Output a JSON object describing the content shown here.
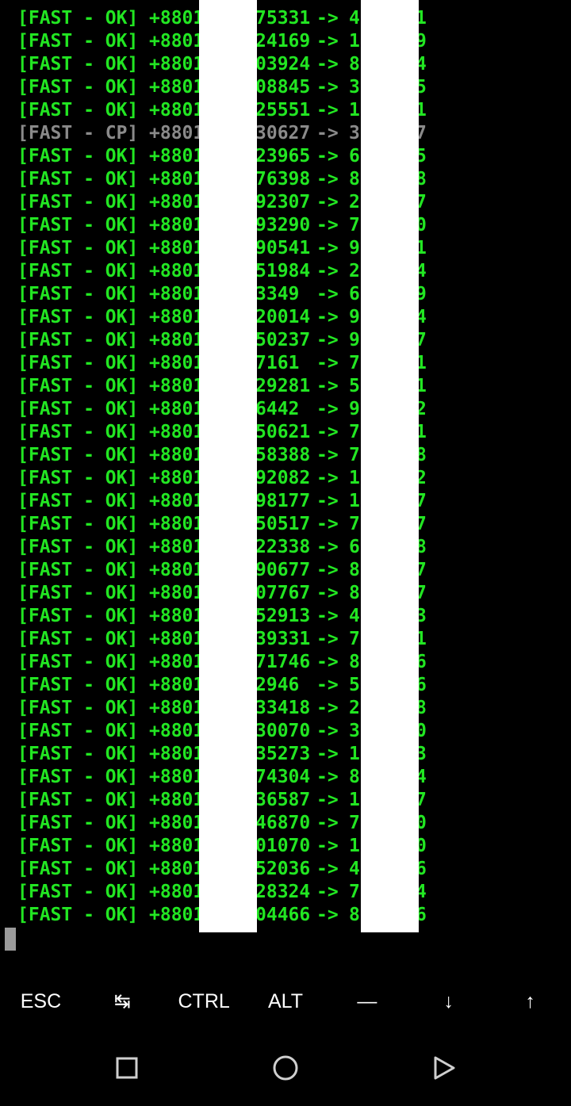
{
  "terminal": {
    "lines": [
      {
        "tag": "[FAST - OK]",
        "phone_prefix": "+8801",
        "phone_suffix": "75331",
        "arrow": "->",
        "pass_first": "4",
        "pass_last": "1",
        "status": "ok"
      },
      {
        "tag": "[FAST - OK]",
        "phone_prefix": "+8801",
        "phone_suffix": "24169",
        "arrow": "->",
        "pass_first": "1",
        "pass_last": "9",
        "status": "ok"
      },
      {
        "tag": "[FAST - OK]",
        "phone_prefix": "+8801",
        "phone_suffix": "03924",
        "arrow": "->",
        "pass_first": "8",
        "pass_last": "4",
        "status": "ok"
      },
      {
        "tag": "[FAST - OK]",
        "phone_prefix": "+8801",
        "phone_suffix": "08845",
        "arrow": "->",
        "pass_first": "3",
        "pass_last": "5",
        "status": "ok"
      },
      {
        "tag": "[FAST - OK]",
        "phone_prefix": "+8801",
        "phone_suffix": "25551",
        "arrow": "->",
        "pass_first": "1",
        "pass_last": "1",
        "status": "ok"
      },
      {
        "tag": "[FAST - CP]",
        "phone_prefix": "+8801",
        "phone_suffix": "30627",
        "arrow": "->",
        "pass_first": "3",
        "pass_last": "7",
        "status": "cp"
      },
      {
        "tag": "[FAST - OK]",
        "phone_prefix": "+8801",
        "phone_suffix": "23965",
        "arrow": "->",
        "pass_first": "6",
        "pass_last": "5",
        "status": "ok"
      },
      {
        "tag": "[FAST - OK]",
        "phone_prefix": "+8801",
        "phone_suffix": "76398",
        "arrow": "->",
        "pass_first": "8",
        "pass_last": "8",
        "status": "ok"
      },
      {
        "tag": "[FAST - OK]",
        "phone_prefix": "+8801",
        "phone_suffix": "92307",
        "arrow": "->",
        "pass_first": "2",
        "pass_last": "7",
        "status": "ok"
      },
      {
        "tag": "[FAST - OK]",
        "phone_prefix": "+8801",
        "phone_suffix": "93290",
        "arrow": "->",
        "pass_first": "7",
        "pass_last": "0",
        "status": "ok"
      },
      {
        "tag": "[FAST - OK]",
        "phone_prefix": "+8801",
        "phone_suffix": "90541",
        "arrow": "->",
        "pass_first": "9",
        "pass_last": "1",
        "status": "ok"
      },
      {
        "tag": "[FAST - OK]",
        "phone_prefix": "+8801",
        "phone_suffix": "51984",
        "arrow": "->",
        "pass_first": "2",
        "pass_last": "4",
        "status": "ok"
      },
      {
        "tag": "[FAST - OK]",
        "phone_prefix": "+8801",
        "phone_suffix": "3349",
        "arrow": "->",
        "pass_first": "6",
        "pass_last": "9",
        "status": "ok"
      },
      {
        "tag": "[FAST - OK]",
        "phone_prefix": "+8801",
        "phone_suffix": "20014",
        "arrow": "->",
        "pass_first": "9",
        "pass_last": "4",
        "status": "ok"
      },
      {
        "tag": "[FAST - OK]",
        "phone_prefix": "+8801",
        "phone_suffix": "50237",
        "arrow": "->",
        "pass_first": "9",
        "pass_last": "7",
        "status": "ok"
      },
      {
        "tag": "[FAST - OK]",
        "phone_prefix": "+8801",
        "phone_suffix": "7161",
        "arrow": "->",
        "pass_first": "7",
        "pass_last": "1",
        "status": "ok"
      },
      {
        "tag": "[FAST - OK]",
        "phone_prefix": "+8801",
        "phone_suffix": "29281",
        "arrow": "->",
        "pass_first": "5",
        "pass_last": "1",
        "status": "ok"
      },
      {
        "tag": "[FAST - OK]",
        "phone_prefix": "+8801",
        "phone_suffix": "6442",
        "arrow": "->",
        "pass_first": "9",
        "pass_last": "2",
        "status": "ok"
      },
      {
        "tag": "[FAST - OK]",
        "phone_prefix": "+8801",
        "phone_suffix": "50621",
        "arrow": "->",
        "pass_first": "7",
        "pass_last": "1",
        "status": "ok"
      },
      {
        "tag": "[FAST - OK]",
        "phone_prefix": "+8801",
        "phone_suffix": "58388",
        "arrow": "->",
        "pass_first": "7",
        "pass_last": "8",
        "status": "ok"
      },
      {
        "tag": "[FAST - OK]",
        "phone_prefix": "+8801",
        "phone_suffix": "92082",
        "arrow": "->",
        "pass_first": "1",
        "pass_last": "2",
        "status": "ok"
      },
      {
        "tag": "[FAST - OK]",
        "phone_prefix": "+8801",
        "phone_suffix": "98177",
        "arrow": "->",
        "pass_first": "1",
        "pass_last": "7",
        "status": "ok"
      },
      {
        "tag": "[FAST - OK]",
        "phone_prefix": "+8801",
        "phone_suffix": "50517",
        "arrow": "->",
        "pass_first": "7",
        "pass_last": "7",
        "status": "ok"
      },
      {
        "tag": "[FAST - OK]",
        "phone_prefix": "+8801",
        "phone_suffix": "22338",
        "arrow": "->",
        "pass_first": "6",
        "pass_last": "8",
        "status": "ok"
      },
      {
        "tag": "[FAST - OK]",
        "phone_prefix": "+8801",
        "phone_suffix": "90677",
        "arrow": "->",
        "pass_first": "8",
        "pass_last": "7",
        "status": "ok"
      },
      {
        "tag": "[FAST - OK]",
        "phone_prefix": "+8801",
        "phone_suffix": "07767",
        "arrow": "->",
        "pass_first": "8",
        "pass_last": "7",
        "status": "ok"
      },
      {
        "tag": "[FAST - OK]",
        "phone_prefix": "+8801",
        "phone_suffix": "52913",
        "arrow": "->",
        "pass_first": "4",
        "pass_last": "3",
        "status": "ok"
      },
      {
        "tag": "[FAST - OK]",
        "phone_prefix": "+8801",
        "phone_suffix": "39331",
        "arrow": "->",
        "pass_first": "7",
        "pass_last": "1",
        "status": "ok"
      },
      {
        "tag": "[FAST - OK]",
        "phone_prefix": "+8801",
        "phone_suffix": "71746",
        "arrow": "->",
        "pass_first": "8",
        "pass_last": "6",
        "status": "ok"
      },
      {
        "tag": "[FAST - OK]",
        "phone_prefix": "+8801",
        "phone_suffix": "2946",
        "arrow": "->",
        "pass_first": "5",
        "pass_last": "6",
        "status": "ok"
      },
      {
        "tag": "[FAST - OK]",
        "phone_prefix": "+8801",
        "phone_suffix": "33418",
        "arrow": "->",
        "pass_first": "2",
        "pass_last": "8",
        "status": "ok"
      },
      {
        "tag": "[FAST - OK]",
        "phone_prefix": "+8801",
        "phone_suffix": "30070",
        "arrow": "->",
        "pass_first": "3",
        "pass_last": "0",
        "status": "ok"
      },
      {
        "tag": "[FAST - OK]",
        "phone_prefix": "+8801",
        "phone_suffix": "35273",
        "arrow": "->",
        "pass_first": "1",
        "pass_last": "3",
        "status": "ok"
      },
      {
        "tag": "[FAST - OK]",
        "phone_prefix": "+8801",
        "phone_suffix": "74304",
        "arrow": "->",
        "pass_first": "8",
        "pass_last": "4",
        "status": "ok"
      },
      {
        "tag": "[FAST - OK]",
        "phone_prefix": "+8801",
        "phone_suffix": "36587",
        "arrow": "->",
        "pass_first": "1",
        "pass_last": "7",
        "status": "ok"
      },
      {
        "tag": "[FAST - OK]",
        "phone_prefix": "+8801",
        "phone_suffix": "46870",
        "arrow": "->",
        "pass_first": "7",
        "pass_last": "0",
        "status": "ok"
      },
      {
        "tag": "[FAST - OK]",
        "phone_prefix": "+8801",
        "phone_suffix": "01070",
        "arrow": "->",
        "pass_first": "1",
        "pass_last": "0",
        "status": "ok"
      },
      {
        "tag": "[FAST - OK]",
        "phone_prefix": "+8801",
        "phone_suffix": "52036",
        "arrow": "->",
        "pass_first": "4",
        "pass_last": "6",
        "status": "ok"
      },
      {
        "tag": "[FAST - OK]",
        "phone_prefix": "+8801",
        "phone_suffix": "28324",
        "arrow": "->",
        "pass_first": "7",
        "pass_last": "4",
        "status": "ok"
      },
      {
        "tag": "[FAST - OK]",
        "phone_prefix": "+8801",
        "phone_suffix": "04466",
        "arrow": "->",
        "pass_first": "8",
        "pass_last": "6",
        "status": "ok"
      }
    ],
    "colors": {
      "ok": "#22e622",
      "cp": "#8a8a8a",
      "background": "#000000",
      "cursor": "#9a9a9a"
    }
  },
  "extra_keys": [
    {
      "label": "ESC",
      "name": "esc-key"
    },
    {
      "label": "↹",
      "name": "tab-key"
    },
    {
      "label": "CTRL",
      "name": "ctrl-key"
    },
    {
      "label": "ALT",
      "name": "alt-key"
    },
    {
      "label": "—",
      "name": "dash-key"
    },
    {
      "label": "↓",
      "name": "arrow-down-key"
    },
    {
      "label": "↑",
      "name": "arrow-up-key"
    }
  ],
  "navbar": {
    "buttons": [
      {
        "name": "recents-button",
        "icon": "square-icon"
      },
      {
        "name": "home-button",
        "icon": "circle-icon"
      },
      {
        "name": "back-button",
        "icon": "triangle-icon"
      }
    ]
  }
}
